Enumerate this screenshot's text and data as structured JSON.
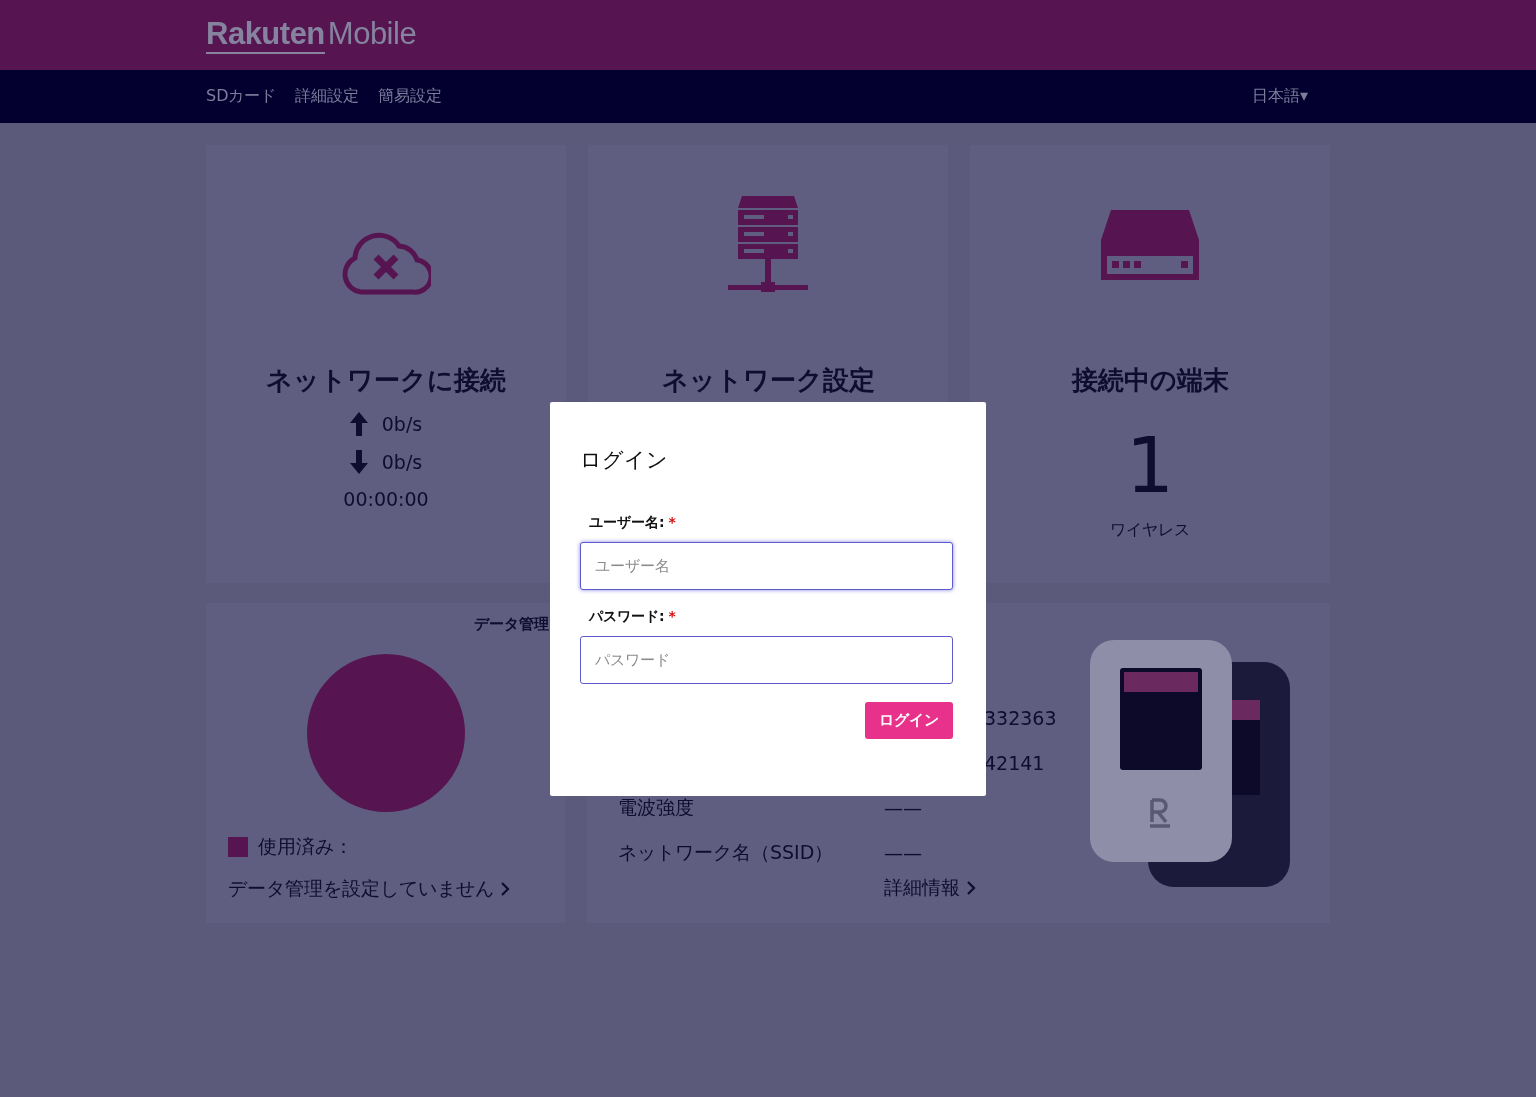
{
  "header": {
    "logo": {
      "brand": "Rakuten",
      "product": "Mobile"
    }
  },
  "nav": {
    "items": [
      {
        "label": "SDカード"
      },
      {
        "label": "詳細設定"
      },
      {
        "label": "簡易設定"
      }
    ],
    "language": {
      "label": "日本語",
      "caret": "▾"
    }
  },
  "status_cards": [
    {
      "kind": "connection",
      "title": "ネットワークに接続",
      "upload": "0b/s",
      "download": "0b/s",
      "duration": "00:00:00"
    },
    {
      "kind": "network",
      "title": "ネットワーク設定"
    },
    {
      "kind": "devices",
      "title": "接続中の端末",
      "count": "1",
      "count_label": "ワイヤレス"
    }
  ],
  "data_card": {
    "title": "データ管理",
    "legend": {
      "label": "使用済み：",
      "color": "#561550"
    },
    "link": "データ管理を設定していません"
  },
  "info_card": {
    "rows": [
      {
        "kind": "partial",
        "value": "332363"
      },
      {
        "kind": "partial",
        "value": "42141"
      },
      {
        "kind": "full",
        "label": "電波強度",
        "value": "——"
      },
      {
        "kind": "full",
        "label": "ネットワーク名（SSID）",
        "value": "——"
      }
    ],
    "link": "詳細情報"
  },
  "login_dialog": {
    "title": "ログイン",
    "fields": [
      {
        "label": "ユーザー名:",
        "required_mark": "*",
        "placeholder": "ユーザー名",
        "focused": true
      },
      {
        "label": "パスワード:",
        "required_mark": "*",
        "placeholder": "パスワード",
        "focused": false
      }
    ],
    "button": "ログイン"
  }
}
